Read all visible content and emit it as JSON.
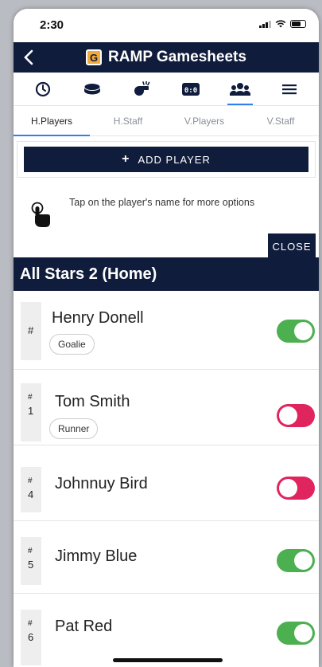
{
  "status": {
    "time": "2:30"
  },
  "app": {
    "title": "RAMP Gamesheets",
    "logo_letter": "G"
  },
  "iconbar": [
    "clock-icon",
    "puck-icon",
    "whistle-icon",
    "scoreboard-icon",
    "players-icon",
    "menu-icon"
  ],
  "scoreboard_text": "0:0",
  "tabs": [
    "H.Players",
    "H.Staff",
    "V.Players",
    "V.Staff"
  ],
  "add_player": {
    "label": "ADD PLAYER",
    "plus": "+"
  },
  "hint": {
    "message": "Tap on the player's name for more options",
    "close_label": "CLOSE"
  },
  "team": {
    "header": "All Stars 2 (Home)"
  },
  "players": [
    {
      "hash": "#",
      "number": "",
      "name": "Henry Donell",
      "badge": "Goalie",
      "active": true
    },
    {
      "hash": "#",
      "number": "1",
      "name": "Tom Smith",
      "badge": "Runner",
      "active": false
    },
    {
      "hash": "#",
      "number": "4",
      "name": "Johnnuy Bird",
      "badge": "",
      "active": false
    },
    {
      "hash": "#",
      "number": "5",
      "name": "Jimmy Blue",
      "badge": "",
      "active": true
    },
    {
      "hash": "#",
      "number": "6",
      "name": "Pat Red",
      "badge": "",
      "active": true
    }
  ],
  "colors": {
    "navy": "#101c3b",
    "accent": "#2f80ed",
    "toggle_on": "#4caf50",
    "toggle_off": "#e0245e"
  }
}
